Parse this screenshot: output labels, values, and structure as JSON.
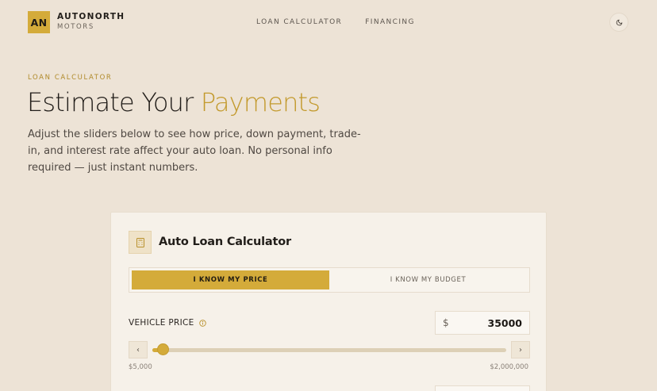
{
  "brand": {
    "logo_text": "AN",
    "name": "AUTONORTH",
    "subtitle": "MOTORS"
  },
  "nav": {
    "items": [
      {
        "label": "LOAN CALCULATOR"
      },
      {
        "label": "FINANCING"
      }
    ]
  },
  "theme_toggle": {
    "icon": "moon-icon"
  },
  "hero": {
    "eyebrow": "LOAN CALCULATOR",
    "title_plain": "Estimate Your",
    "title_accent": "Payments",
    "description": "Adjust the sliders below to see how price, down payment, trade-in, and interest rate affect your auto loan. No personal info required — just instant numbers."
  },
  "calculator": {
    "icon": "calculator-icon",
    "title": "Auto Loan Calculator",
    "tabs": [
      {
        "label": "I KNOW MY PRICE",
        "active": true
      },
      {
        "label": "I KNOW MY BUDGET",
        "active": false
      }
    ],
    "vehicle_price": {
      "label": "VEHICLE PRICE",
      "info_icon": "info-icon",
      "currency": "$",
      "value": "35000",
      "min_label": "$5,000",
      "max_label": "$2,000,000",
      "slider_fraction": 0.03
    }
  },
  "colors": {
    "background": "#ede3d6",
    "accent": "#d4ab3a",
    "accent_text": "#c39a2d",
    "card": "#f6f1e9"
  }
}
